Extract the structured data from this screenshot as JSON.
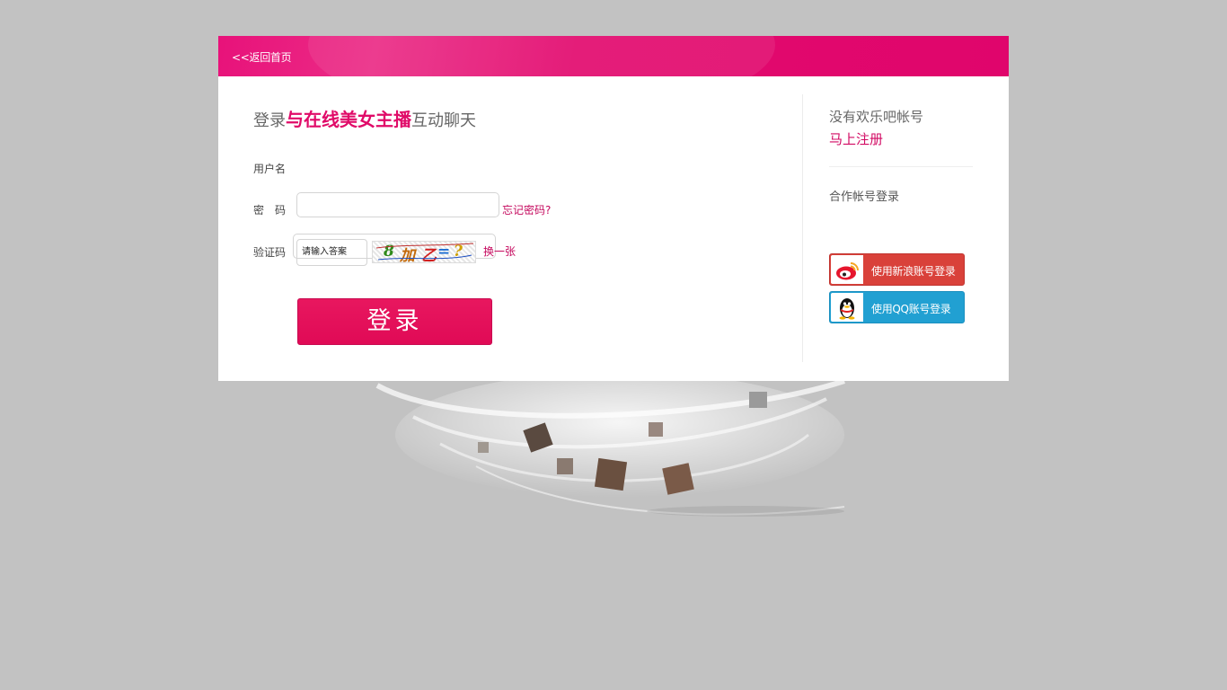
{
  "header": {
    "back_link": "<<返回首页"
  },
  "login": {
    "headline_prefix": "登录",
    "headline_emphasis": "与在线美女主播",
    "headline_suffix": "互动聊天",
    "username_label": "用户名",
    "username_value": "",
    "password_label": "密　码",
    "password_value": "",
    "forgot_password": "忘记密码?",
    "captcha_label": "验证码",
    "captcha_placeholder": "请输入答案",
    "captcha_text": [
      "8",
      "加",
      "乙",
      "=",
      "?"
    ],
    "refresh_captcha": "换一张",
    "submit_label": "登录"
  },
  "sidebar": {
    "no_account": "没有欢乐吧帐号",
    "register_link": "马上注册",
    "partner_title": "合作帐号登录",
    "weibo_button": "使用新浪账号登录",
    "qq_button": "使用QQ账号登录"
  },
  "colors": {
    "page_bg": "#c2c2c2",
    "brand_pink": "#e0056c",
    "link_pink": "#c5095e",
    "weibo_red": "#d9413a",
    "qq_blue": "#21a0d2"
  },
  "icons": {
    "weibo": "weibo-icon",
    "qq": "qq-penguin-icon"
  }
}
